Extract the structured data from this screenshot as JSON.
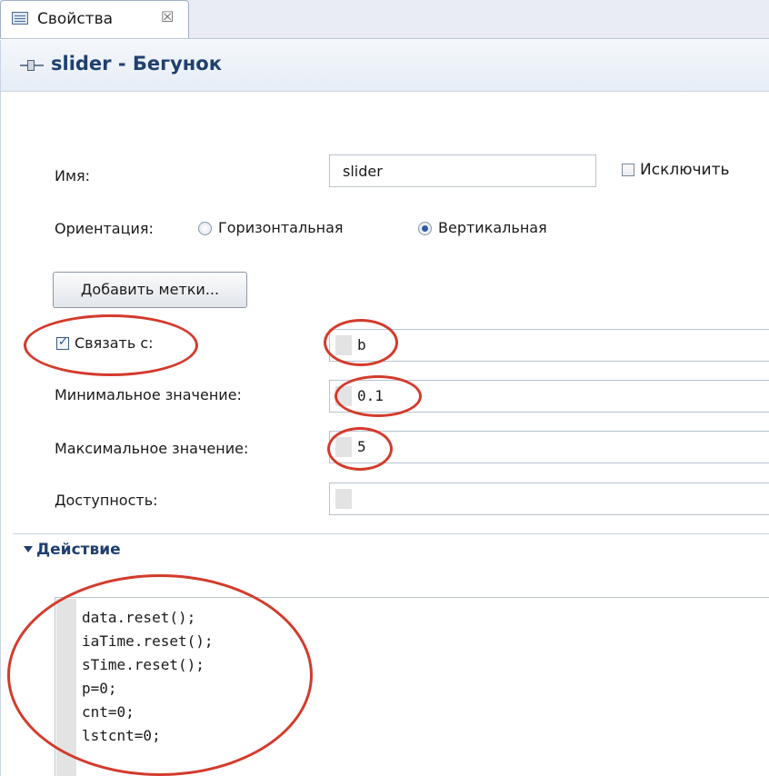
{
  "tab": {
    "label": "Свойства",
    "close": "☒"
  },
  "header": {
    "title": "slider - Бегунок"
  },
  "form": {
    "name_label": "Имя:",
    "name_value": "slider",
    "exclude_label": "Исключить",
    "orientation_label": "Ориентация:",
    "orientation_options": [
      "Горизонтальная",
      "Вертикальная"
    ],
    "orientation_selected": "Вертикальная",
    "add_marks_button": "Добавить метки...",
    "bind_label": "Связать с:",
    "bind_checked": true,
    "bind_value": "b",
    "min_label": "Минимальное значение:",
    "min_value": "0.1",
    "max_label": "Максимальное значение:",
    "max_value": "5",
    "enabled_label": "Доступность:",
    "enabled_value": ""
  },
  "section": {
    "title": "Действие",
    "code_lines": [
      "data.reset();",
      "iaTime.reset();",
      "sTime.reset();",
      "p=0;",
      "cnt=0;",
      "lstcnt=0;"
    ]
  },
  "colors": {
    "annotation": "#d33b2c",
    "accent": "#1f3f6f"
  }
}
